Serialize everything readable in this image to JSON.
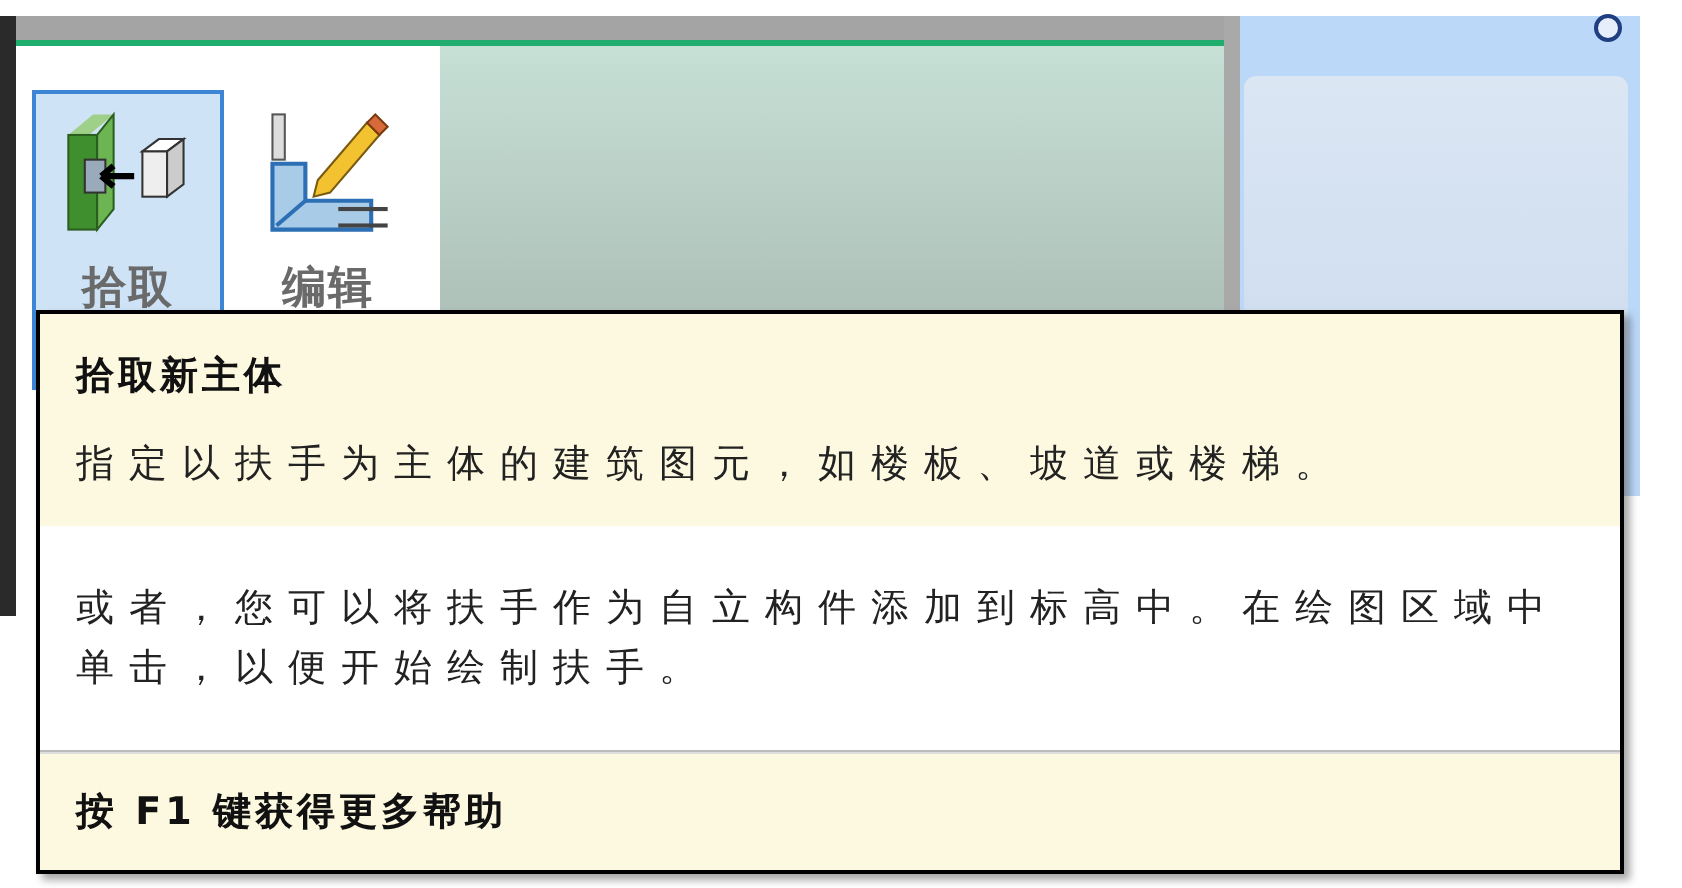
{
  "ribbon": {
    "buttons": [
      {
        "label": "拾取",
        "kind": "pick-host",
        "selected": true
      },
      {
        "label": "编辑",
        "kind": "edit-joins",
        "selected": false
      }
    ]
  },
  "tooltip": {
    "title": "拾取新主体",
    "description": "指定以扶手为主体的建筑图元，如楼板、坡道或楼梯。",
    "details": "或者，您可以将扶手作为自立构件添加到标高中。在绘图区域中单击，以便开始绘制扶手。",
    "help": "按 F1 键获得更多帮助"
  }
}
